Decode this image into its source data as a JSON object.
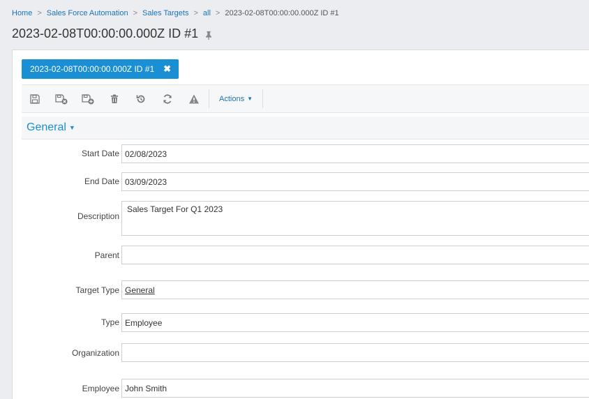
{
  "breadcrumb": {
    "items": [
      "Home",
      "Sales Force Automation",
      "Sales Targets",
      "all"
    ],
    "current": "2023-02-08T00:00:00.000Z ID #1"
  },
  "page": {
    "title": "2023-02-08T00:00:00.000Z ID #1"
  },
  "record_tab": {
    "label": "2023-02-08T00:00:00.000Z ID #1"
  },
  "toolbar": {
    "icons": [
      "save-icon",
      "save-close-icon",
      "save-new-icon",
      "delete-icon",
      "undo-icon",
      "refresh-icon",
      "warning-icon"
    ],
    "actions_label": "Actions"
  },
  "section": {
    "title": "General"
  },
  "fields": {
    "start_date": {
      "label": "Start Date",
      "value": "02/08/2023"
    },
    "end_date": {
      "label": "End Date",
      "value": "03/09/2023"
    },
    "description": {
      "label": "Description",
      "value": "Sales Target For Q1 2023"
    },
    "parent": {
      "label": "Parent",
      "value": ""
    },
    "target_type": {
      "label": "Target Type",
      "value": "General"
    },
    "type": {
      "label": "Type",
      "value": "Employee"
    },
    "organization": {
      "label": "Organization",
      "value": ""
    },
    "employee": {
      "label": "Employee",
      "value": "John Smith"
    }
  },
  "colors": {
    "accent": "#1b8fd4",
    "link": "#1a73b8",
    "background": "#ebedf0"
  }
}
